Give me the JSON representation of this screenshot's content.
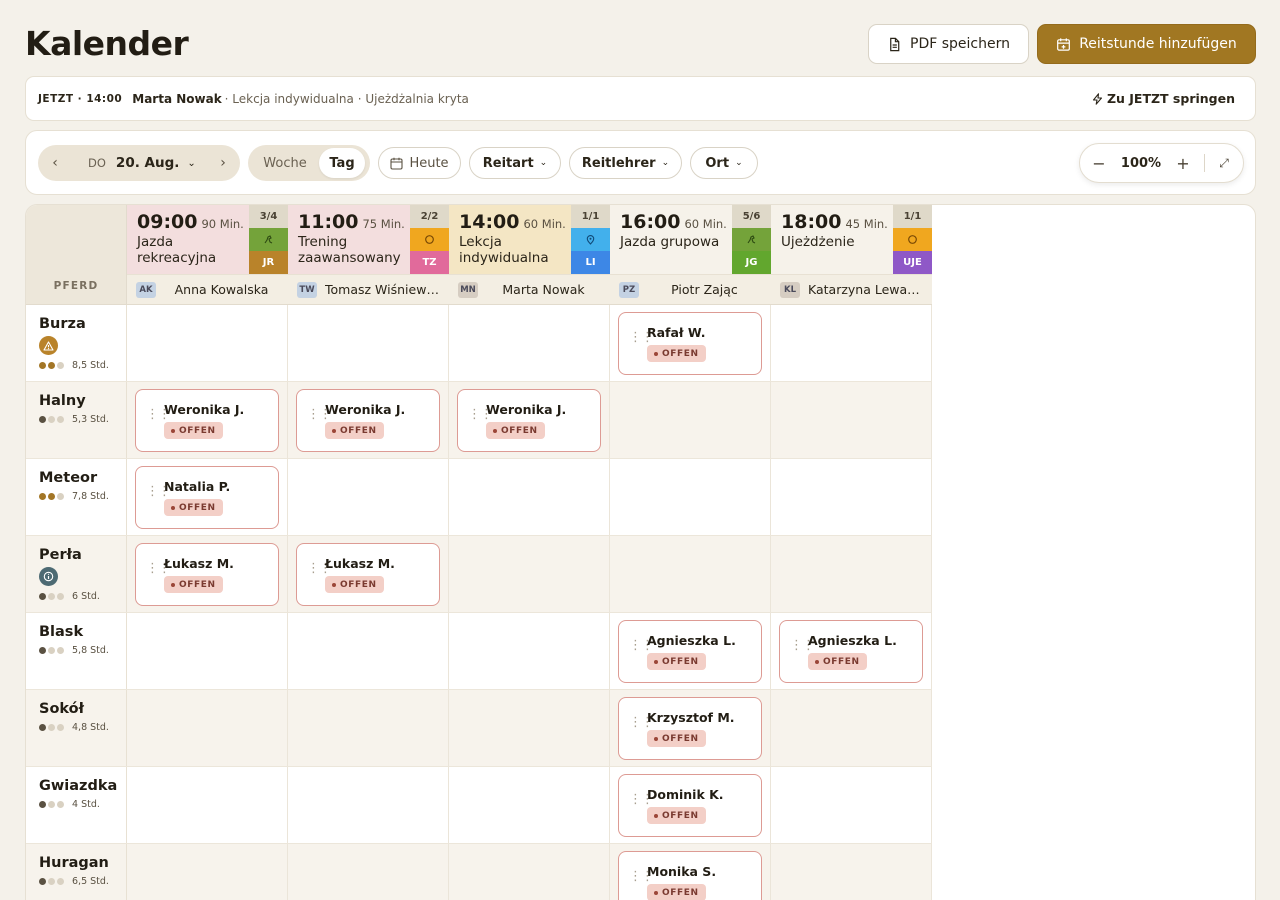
{
  "header": {
    "title": "Kalender",
    "pdf_label": "PDF speichern",
    "add_label": "Reitstunde hinzufügen"
  },
  "now_bar": {
    "tag": "JETZT · 14:00",
    "name": "Marta Nowak",
    "rest": "· Lekcja indywidualna · Ujeżdżalnia kryta",
    "jump_label": "Zu JETZT springen"
  },
  "toolbar": {
    "weekday": "DO",
    "date": "20. Aug.",
    "view_week": "Woche",
    "view_day": "Tag",
    "today": "Heute",
    "filter_type": "Reitart",
    "filter_teacher": "Reitlehrer",
    "filter_location": "Ort",
    "zoom": "100%"
  },
  "grid": {
    "corner_label": "PFERD",
    "status_label": "OFFEN",
    "lessons": [
      {
        "time": "09:00",
        "duration": "90 Min.",
        "type": "Jazda rekreacyjna",
        "capacity": "3/4",
        "code": "JR",
        "bg": "#f3dede",
        "icon_bg": "#74a33a",
        "code_bg": "#b9832a",
        "icon": "horse-icon",
        "teacher_initials": "AK",
        "teacher": "Anna Kowalska",
        "ini_bg": "#c4d2e3"
      },
      {
        "time": "11:00",
        "duration": "75 Min.",
        "type": "Trening zaawansowany",
        "capacity": "2/2",
        "code": "TZ",
        "bg": "#f3dede",
        "icon_bg": "#f0a71f",
        "code_bg": "#e16a9b",
        "icon": "circle-icon",
        "teacher_initials": "TW",
        "teacher": "Tomasz Wiśniewski",
        "ini_bg": "#c4d2e3"
      },
      {
        "time": "14:00",
        "duration": "60 Min.",
        "type": "Lekcja indywidualna",
        "capacity": "1/1",
        "code": "LI",
        "bg": "#f4e6c4",
        "icon_bg": "#42b0ec",
        "code_bg": "#3d87e6",
        "icon": "pin-icon",
        "teacher_initials": "MN",
        "teacher": "Marta Nowak",
        "ini_bg": "#d6cdc2"
      },
      {
        "time": "16:00",
        "duration": "60 Min.",
        "type": "Jazda grupowa",
        "capacity": "5/6",
        "code": "JG",
        "bg": "#f6f2ea",
        "icon_bg": "#74a33a",
        "code_bg": "#62a72e",
        "icon": "horse-icon",
        "teacher_initials": "PZ",
        "teacher": "Piotr Zając",
        "ini_bg": "#c4d2e3"
      },
      {
        "time": "18:00",
        "duration": "45 Min.",
        "type": "Ujeżdżenie",
        "capacity": "1/1",
        "code": "UJE",
        "bg": "#f6f2ea",
        "icon_bg": "#f0a71f",
        "code_bg": "#8f58c7",
        "icon": "circle-icon",
        "teacher_initials": "KL",
        "teacher": "Katarzyna Lewandowska",
        "ini_bg": "#d6cdc2"
      }
    ],
    "horses": [
      {
        "name": "Burza",
        "hours": "8,5 Std.",
        "level": 2,
        "alert": "warning-icon"
      },
      {
        "name": "Halny",
        "hours": "5,3 Std.",
        "level": 1,
        "alert": ""
      },
      {
        "name": "Meteor",
        "hours": "7,8 Std.",
        "level": 2,
        "alert": ""
      },
      {
        "name": "Perła",
        "hours": "6 Std.",
        "level": 1,
        "alert": "info-icon"
      },
      {
        "name": "Blask",
        "hours": "5,8 Std.",
        "level": 1,
        "alert": ""
      },
      {
        "name": "Sokół",
        "hours": "4,8 Std.",
        "level": 1,
        "alert": ""
      },
      {
        "name": "Gwiazdka",
        "hours": "4 Std.",
        "level": 1,
        "alert": ""
      },
      {
        "name": "Huragan",
        "hours": "6,5 Std.",
        "level": 1,
        "alert": ""
      }
    ],
    "bookings": [
      {
        "row": 0,
        "col": 3,
        "rider": "Rafał W."
      },
      {
        "row": 1,
        "col": 0,
        "rider": "Weronika J."
      },
      {
        "row": 1,
        "col": 1,
        "rider": "Weronika J."
      },
      {
        "row": 1,
        "col": 2,
        "rider": "Weronika J."
      },
      {
        "row": 2,
        "col": 0,
        "rider": "Natalia P."
      },
      {
        "row": 3,
        "col": 0,
        "rider": "Łukasz M."
      },
      {
        "row": 3,
        "col": 1,
        "rider": "Łukasz M."
      },
      {
        "row": 4,
        "col": 3,
        "rider": "Agnieszka L."
      },
      {
        "row": 4,
        "col": 4,
        "rider": "Agnieszka L."
      },
      {
        "row": 5,
        "col": 3,
        "rider": "Krzysztof M."
      },
      {
        "row": 6,
        "col": 3,
        "rider": "Dominik K."
      },
      {
        "row": 7,
        "col": 3,
        "rider": "Monika S."
      }
    ]
  }
}
